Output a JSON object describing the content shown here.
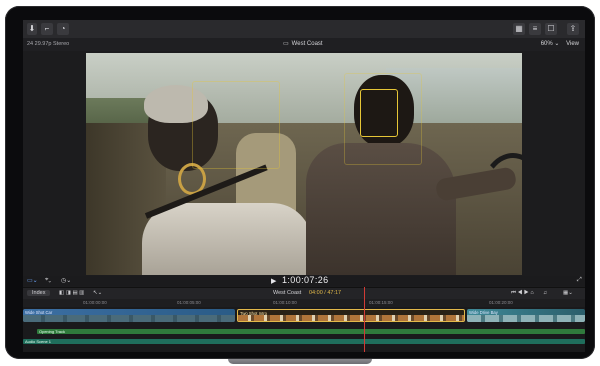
{
  "viewer": {
    "clip_info": "24 29.97p Stereo",
    "title": "West Coast",
    "zoom": "60%",
    "zoom_caret": "⌄",
    "view_label": "View"
  },
  "transport": {
    "timecode": "1:00:07:26"
  },
  "timeline": {
    "index_label": "Index",
    "project_name": "West Coast",
    "duration": "04:00 / 47:17",
    "ruler_marks": [
      "01:00:00:00",
      "01:00:05:00",
      "01:00:10:00",
      "01:00:15:00",
      "01:00:20:00"
    ],
    "clips": [
      {
        "label": "Wide Shot Car",
        "color": "#2a5b86"
      },
      {
        "label": "Two Shot Intro",
        "color": "#8a5a2a"
      },
      {
        "label": "Wide Drive Bay",
        "color": "#2b5e6b"
      }
    ],
    "audio_tracks": [
      {
        "label": "Opening Track",
        "color": "#2f7a3c"
      },
      {
        "label": "Audio Scene 1",
        "color": "#1f6e5c"
      }
    ]
  },
  "icons": [
    "import-icon",
    "keyword-icon",
    "background-tasks-icon",
    "browser-icon",
    "inspector-icon",
    "share-icon",
    "play-icon",
    "fullscreen-icon"
  ]
}
